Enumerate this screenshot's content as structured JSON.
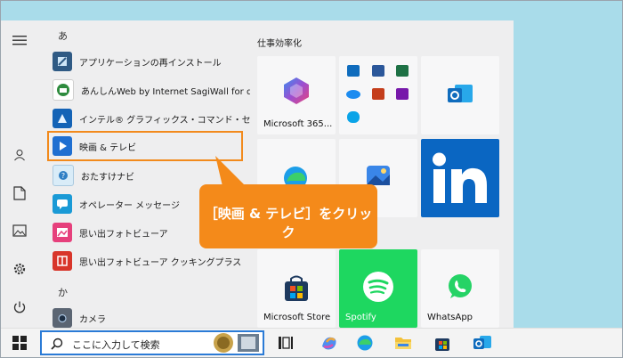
{
  "app_list": {
    "section_a": "あ",
    "section_ka": "か",
    "items": [
      {
        "label": "アプリケーションの再インストール",
        "icon": "reinstall-icon"
      },
      {
        "label": "あんしんWeb by Internet SagiWall for d...",
        "icon": "sagiwall-icon"
      },
      {
        "label": "インテル® グラフィックス・コマンド・センター",
        "icon": "intel-graphics-icon"
      },
      {
        "label": "映画 & テレビ",
        "icon": "movies-tv-icon"
      },
      {
        "label": "おたすけナビ",
        "icon": "otasuke-navi-icon"
      },
      {
        "label": "オペレーター メッセージ",
        "icon": "operator-message-icon"
      },
      {
        "label": "思い出フォトビューア",
        "icon": "photo-viewer-icon"
      },
      {
        "label": "思い出フォトビューア クッキングプラス",
        "icon": "photo-viewer-cooking-icon"
      },
      {
        "label": "カメラ",
        "icon": "camera-icon"
      }
    ]
  },
  "pinned": {
    "title": "仕事効率化",
    "tiles": [
      {
        "label": "Microsoft 365...",
        "icon": "microsoft-365-icon"
      },
      {
        "label": "",
        "icon": "office-apps-group-icon"
      },
      {
        "label": "",
        "icon": "outlook-icon"
      },
      {
        "label": "",
        "icon": "edge-icon"
      },
      {
        "label": "",
        "icon": "photos-icon"
      },
      {
        "label": "",
        "icon": "linkedin-icon"
      },
      {
        "label": "Microsoft Store",
        "icon": "store-icon"
      },
      {
        "label": "Spotify",
        "icon": "spotify-icon"
      },
      {
        "label": "WhatsApp",
        "icon": "whatsapp-icon"
      }
    ]
  },
  "callout": {
    "text": "［映画 & テレビ］をクリック"
  },
  "taskbar": {
    "search_placeholder": "ここに入力して検索"
  },
  "colors": {
    "accent_orange": "#f48a1a",
    "linkedin_blue": "#0a66c2",
    "spotify_green": "#1ed760",
    "search_border": "#2b7bd6"
  }
}
